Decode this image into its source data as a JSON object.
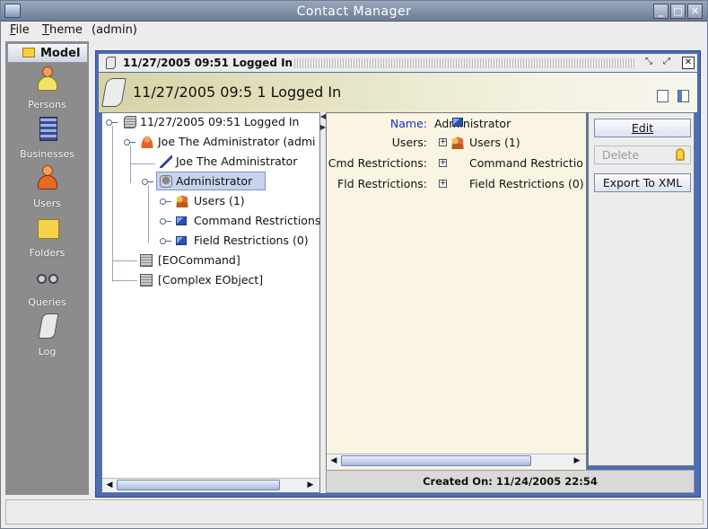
{
  "window": {
    "title": "Contact Manager"
  },
  "menu": {
    "file": "File",
    "theme": "Theme",
    "user": "(admin)"
  },
  "sidebar": {
    "header": "Model",
    "items": [
      {
        "label": "Persons",
        "icon": "person-icon"
      },
      {
        "label": "Businesses",
        "icon": "building-icon"
      },
      {
        "label": "Users",
        "icon": "user-icon"
      },
      {
        "label": "Folders",
        "icon": "folder-icon"
      },
      {
        "label": "Queries",
        "icon": "binoculars-icon"
      },
      {
        "label": "Log",
        "icon": "scroll-icon"
      }
    ]
  },
  "frame": {
    "title": "11/27/2005 09:51 Logged In",
    "banner_title": "11/27/2005 09:5 1 Logged In"
  },
  "tree": {
    "root": "11/27/2005 09:51 Logged In",
    "user": "Joe The Administrator (admi",
    "user_name": "Joe The Administrator",
    "role": "Administrator",
    "users": "Users (1)",
    "cmd_restrictions": "Command Restrictions",
    "field_restrictions": "Field Restrictions (0)",
    "eocommand": "[EOCommand]",
    "complex": "[Complex EObject]"
  },
  "detail": {
    "name_label": "Name:",
    "name_value": "Administrator",
    "users_label": "Users:",
    "users_value": "Users (1)",
    "cmd_label": "Cmd Restrictions:",
    "cmd_value": "Command Restrictio",
    "fld_label": "Fld Restrictions:",
    "fld_value": "Field Restrictions (0)",
    "created": "Created On: 11/24/2005 22:54"
  },
  "buttons": {
    "edit": "Edit",
    "delete": "Delete",
    "export": "Export To XML"
  },
  "colors": {
    "accent": "#4b6cb7",
    "name_label": "#1a2fc8",
    "selection": "#c6d3ee"
  }
}
